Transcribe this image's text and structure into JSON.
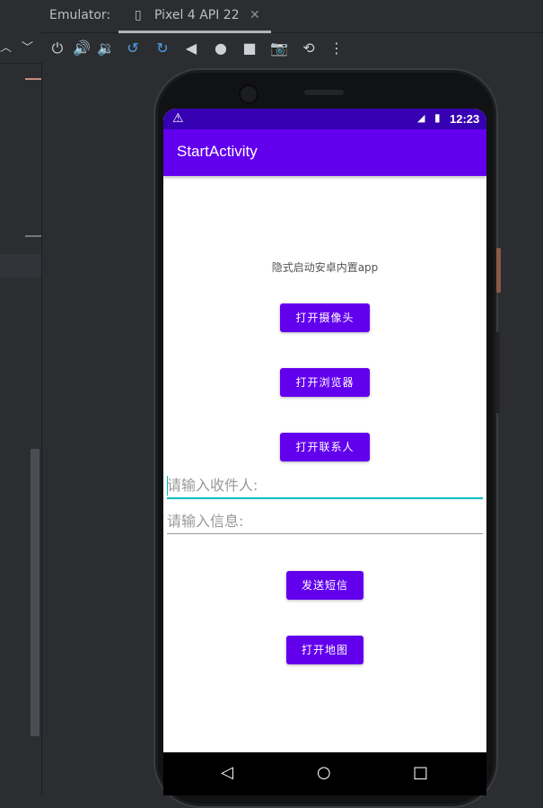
{
  "ide": {
    "label": "Emulator:",
    "device_tab": "Pixel 4 API 22",
    "close_glyph": "✕",
    "toolbar_icons": [
      "power-icon",
      "volume-up-icon",
      "volume-down-icon",
      "rotate-left-icon",
      "rotate-right-icon",
      "back-icon",
      "home-icon",
      "overview-icon",
      "screenshot-icon",
      "snapshot-icon",
      "more-icon"
    ]
  },
  "status": {
    "time": "12:23"
  },
  "app": {
    "title": "StartActivity",
    "subtitle": "隐式启动安卓内置app",
    "buttons": {
      "camera": "打开摄像头",
      "browser": "打开浏览器",
      "contacts": "打开联系人",
      "send_sms": "发送短信",
      "map": "打开地图"
    },
    "fields": {
      "recipient_placeholder": "请输入收件人:",
      "message_placeholder": "请输入信息:"
    }
  },
  "colors": {
    "primary": "#6200ee",
    "primary_dark": "#3700b3",
    "accent": "#00bfc0"
  }
}
